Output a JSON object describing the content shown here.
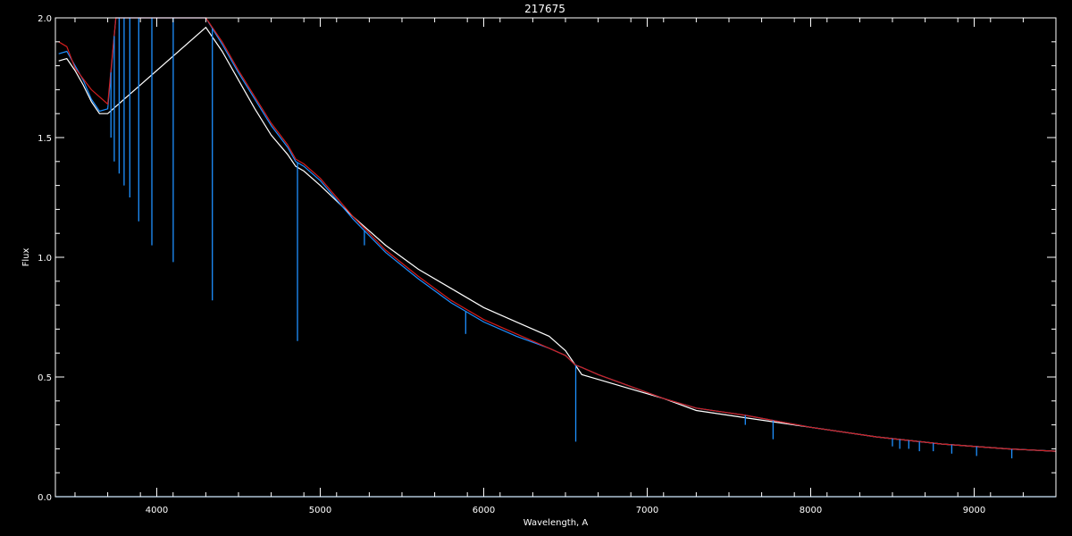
{
  "chart_data": {
    "type": "line",
    "title": "217675",
    "xlabel": "Wavelength, A",
    "ylabel": "Flux",
    "xlim": [
      3380,
      9500
    ],
    "ylim": [
      0.0,
      2.0
    ],
    "xticks": [
      4000,
      5000,
      6000,
      7000,
      8000,
      9000
    ],
    "xtick_labels": [
      "4000",
      "5000",
      "6000",
      "7000",
      "8000",
      "9000"
    ],
    "yticks": [
      0.0,
      0.5,
      1.0,
      1.5,
      2.0
    ],
    "ytick_labels": [
      "0.0",
      "0.5",
      "1.0",
      "1.5",
      "2.0"
    ],
    "grid": false,
    "background": "#000000",
    "axis_color": "#ffffff",
    "series": [
      {
        "color": "#ffffff",
        "x": [
          3400,
          3450,
          3500,
          3550,
          3600,
          3650,
          3700,
          4300,
          4400,
          4500,
          4600,
          4700,
          4800,
          4850,
          4900,
          5000,
          5200,
          5400,
          5600,
          5800,
          6000,
          6200,
          6400,
          6500,
          6560,
          6600,
          6700,
          6900,
          7100,
          7300,
          7600,
          8000,
          8400,
          8800,
          9200,
          9500
        ],
        "y": [
          1.82,
          1.83,
          1.78,
          1.72,
          1.65,
          1.6,
          1.6,
          1.96,
          1.86,
          1.74,
          1.62,
          1.51,
          1.43,
          1.38,
          1.36,
          1.3,
          1.17,
          1.05,
          0.95,
          0.87,
          0.79,
          0.73,
          0.67,
          0.61,
          0.55,
          0.51,
          0.49,
          0.45,
          0.41,
          0.36,
          0.33,
          0.29,
          0.25,
          0.22,
          0.2,
          0.19
        ]
      },
      {
        "color": "#1e90ff",
        "x": [
          3400,
          3450,
          3500,
          3550,
          3600,
          3650,
          3700,
          3750,
          4300,
          4400,
          4500,
          4600,
          4700,
          4800,
          4850,
          4900,
          5000,
          5200,
          5400,
          5600,
          5800,
          6000,
          6200,
          6400,
          6500,
          6560,
          6600,
          6700,
          6900,
          7100,
          7300,
          7600,
          8000,
          8400,
          8800,
          9200,
          9500
        ],
        "y": [
          1.85,
          1.86,
          1.8,
          1.74,
          1.66,
          1.61,
          1.62,
          2.0,
          2.0,
          1.89,
          1.77,
          1.66,
          1.55,
          1.46,
          1.4,
          1.38,
          1.32,
          1.16,
          1.02,
          0.91,
          0.81,
          0.73,
          0.67,
          0.62,
          0.59,
          0.55,
          0.54,
          0.51,
          0.46,
          0.41,
          0.37,
          0.34,
          0.29,
          0.25,
          0.22,
          0.2,
          0.19
        ]
      },
      {
        "color": "#d21e1e",
        "x": [
          3400,
          3450,
          3500,
          3600,
          3700,
          3750,
          4300,
          4400,
          4500,
          4600,
          4700,
          4800,
          4850,
          4900,
          5000,
          5200,
          5400,
          5600,
          5800,
          6000,
          6200,
          6400,
          6500,
          6560,
          6600,
          6700,
          6900,
          7100,
          7300,
          7600,
          8000,
          8400,
          8800,
          9200,
          9500
        ],
        "y": [
          1.9,
          1.88,
          1.79,
          1.7,
          1.64,
          2.0,
          2.0,
          1.9,
          1.78,
          1.67,
          1.56,
          1.47,
          1.41,
          1.39,
          1.33,
          1.17,
          1.03,
          0.92,
          0.82,
          0.74,
          0.68,
          0.62,
          0.59,
          0.55,
          0.54,
          0.51,
          0.46,
          0.41,
          0.37,
          0.34,
          0.29,
          0.25,
          0.22,
          0.2,
          0.19
        ]
      },
      {
        "color": "#1e90ff",
        "x": [
          3380,
          9500
        ],
        "y": [
          0.0,
          0.0
        ]
      }
    ],
    "absorption_lines": [
      {
        "x": 3720,
        "y": 1.5
      },
      {
        "x": 3740,
        "y": 1.4
      },
      {
        "x": 3770,
        "y": 1.35
      },
      {
        "x": 3800,
        "y": 1.3
      },
      {
        "x": 3835,
        "y": 1.25
      },
      {
        "x": 3890,
        "y": 1.15
      },
      {
        "x": 3970,
        "y": 1.05
      },
      {
        "x": 4101,
        "y": 0.98
      },
      {
        "x": 4340,
        "y": 0.82
      },
      {
        "x": 4861,
        "y": 0.65
      },
      {
        "x": 5270,
        "y": 1.05
      },
      {
        "x": 5890,
        "y": 0.68
      },
      {
        "x": 6563,
        "y": 0.23
      },
      {
        "x": 7600,
        "y": 0.3
      },
      {
        "x": 7770,
        "y": 0.24
      },
      {
        "x": 8500,
        "y": 0.21
      },
      {
        "x": 8545,
        "y": 0.2
      },
      {
        "x": 8600,
        "y": 0.2
      },
      {
        "x": 8665,
        "y": 0.19
      },
      {
        "x": 8750,
        "y": 0.19
      },
      {
        "x": 8863,
        "y": 0.18
      },
      {
        "x": 9015,
        "y": 0.17
      },
      {
        "x": 9230,
        "y": 0.16
      }
    ]
  }
}
